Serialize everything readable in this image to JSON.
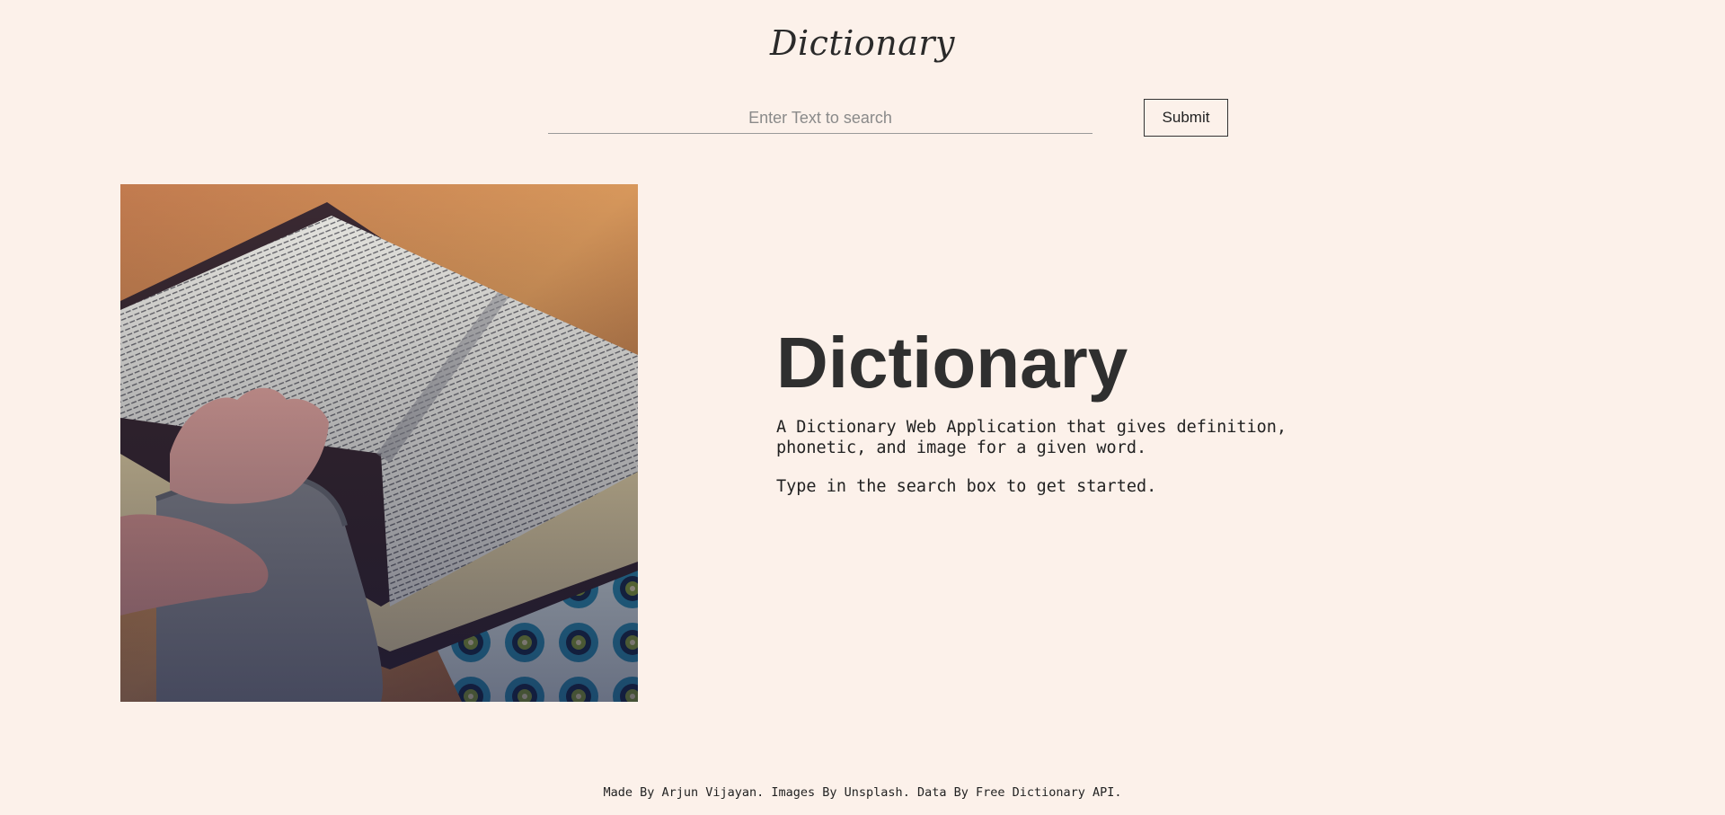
{
  "header": {
    "brand": "Dictionary"
  },
  "search": {
    "placeholder": "Enter Text to search",
    "value": "",
    "submit_label": "Submit"
  },
  "hero": {
    "image_alt": "open-book-photo",
    "title": "Dictionary",
    "description": "A Dictionary Web Application that gives definition, phonetic, and image for a given word.",
    "hint": "Type in the search box to get started."
  },
  "footer": {
    "credits": "Made By Arjun Vijayan. Images By Unsplash. Data By Free Dictionary API."
  },
  "colors": {
    "background": "#fcf1ea",
    "text": "#2f2f2f"
  }
}
